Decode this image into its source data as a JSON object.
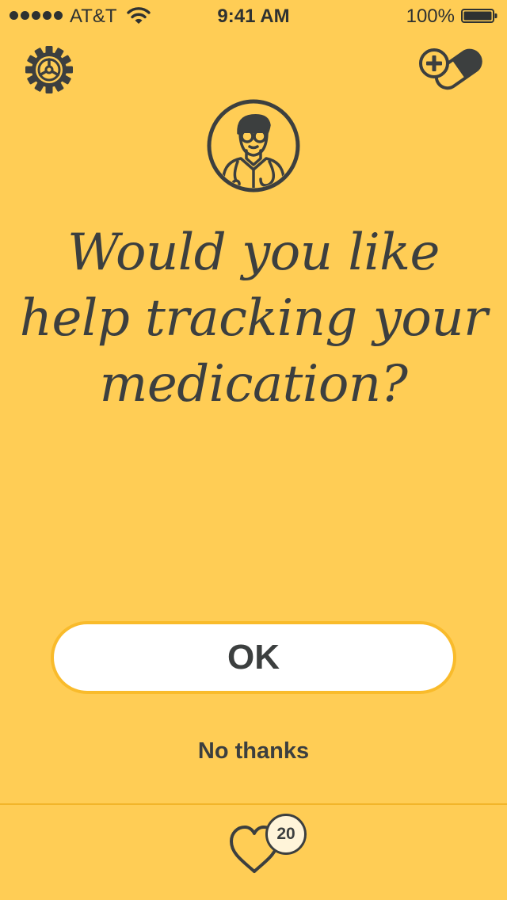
{
  "status_bar": {
    "carrier": "AT&T",
    "time": "9:41 AM",
    "battery_percent": "100%",
    "signal_icon": "signal-dots-icon",
    "wifi_icon": "wifi-icon",
    "battery_icon": "battery-full-icon"
  },
  "header": {
    "settings_icon": "gear-icon",
    "add_medication_icon": "add-pill-icon",
    "avatar_icon": "doctor-icon"
  },
  "prompt": {
    "line1": "Would you like",
    "line2": "help tracking your",
    "line3": "medication?"
  },
  "actions": {
    "ok_label": "OK",
    "decline_label": "No thanks"
  },
  "footer": {
    "heart_icon": "heart-icon",
    "points": "20"
  },
  "colors": {
    "background": "#FFCD55",
    "text": "#3C3F3F",
    "button_fill": "#FFFFFF",
    "button_border": "#F9BB2B",
    "divider": "#F2B52A",
    "badge_fill": "#FFF4D9"
  }
}
